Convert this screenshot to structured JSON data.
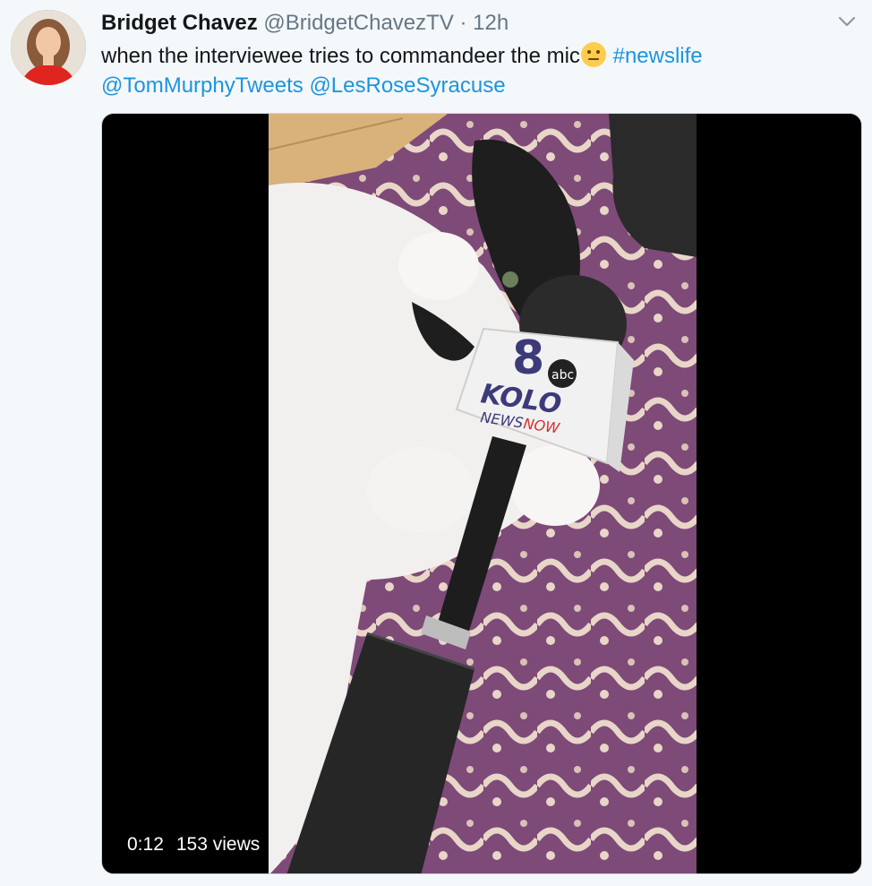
{
  "tweet": {
    "author_name": "Bridget Chavez",
    "author_handle": "@BridgetChavezTV",
    "separator": "·",
    "timestamp": "12h",
    "text_part1": "when the interviewee tries to commandeer the mic",
    "hashtag": "#newslife",
    "mention1": "@TomMurphyTweets",
    "mention2": "@LesRoseSyracuse",
    "emoji": "neutral-face-emoji"
  },
  "video": {
    "duration": "0:12",
    "views": "153 views",
    "mic_flag_brand": "KOLO",
    "mic_flag_sub1": "NEWS",
    "mic_flag_sub2": "NOW",
    "mic_flag_channel": "8",
    "mic_flag_network": "abc"
  },
  "colors": {
    "link": "#1b95e0",
    "text": "#14171a",
    "muted": "#657786",
    "background": "#f5f8fa"
  }
}
